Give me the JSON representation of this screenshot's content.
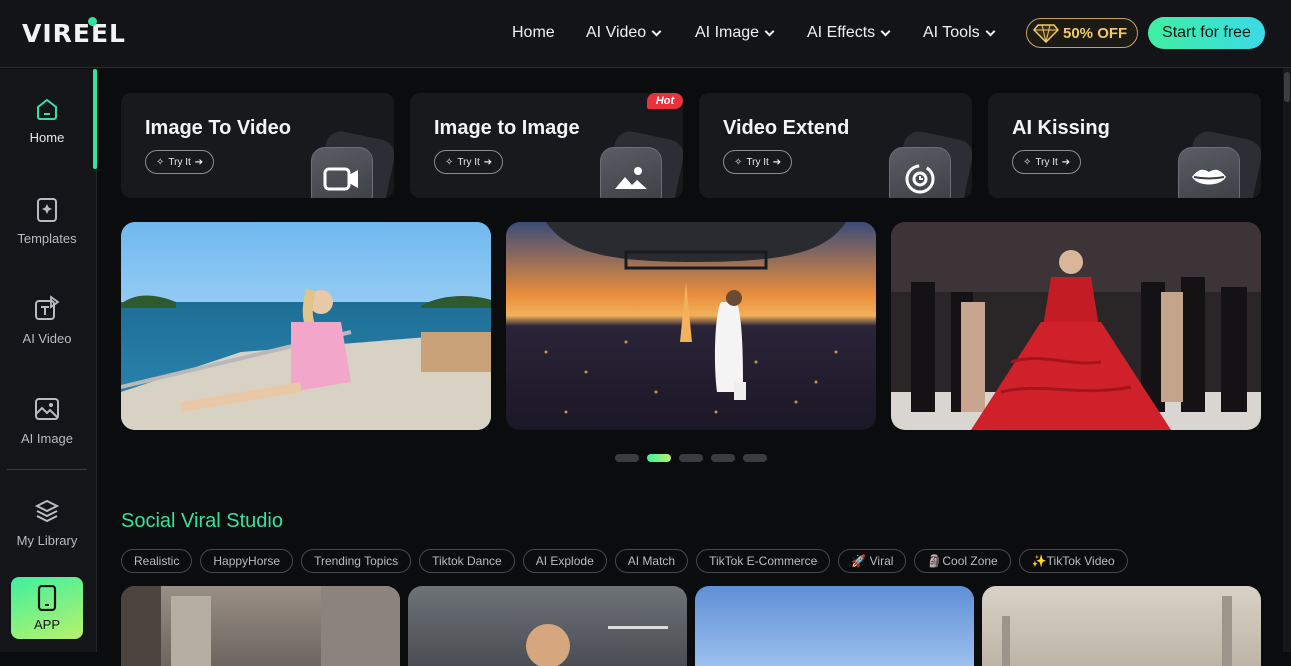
{
  "header": {
    "logo": "VIREEL",
    "nav": [
      {
        "label": "Home",
        "dropdown": false
      },
      {
        "label": "AI Video",
        "dropdown": true
      },
      {
        "label": "AI Image",
        "dropdown": true
      },
      {
        "label": "AI Effects",
        "dropdown": true
      },
      {
        "label": "AI Tools",
        "dropdown": true
      }
    ],
    "promo": "50% OFF",
    "cta": "Start for free"
  },
  "sidebar": {
    "items": [
      {
        "label": "Home",
        "icon": "home-icon",
        "active": true
      },
      {
        "label": "Templates",
        "icon": "templates-icon",
        "active": false
      },
      {
        "label": "AI Video",
        "icon": "ai-video-icon",
        "active": false
      },
      {
        "label": "AI Image",
        "icon": "ai-image-icon",
        "active": false
      },
      {
        "label": "My Library",
        "icon": "layers-icon",
        "active": false
      }
    ],
    "app_label": "APP"
  },
  "tools": [
    {
      "title": "Image To Video",
      "try": "Try It",
      "icon": "video-camera-icon",
      "hot": false
    },
    {
      "title": "Image to Image",
      "try": "Try It",
      "icon": "picture-icon",
      "hot": true
    },
    {
      "title": "Video Extend",
      "try": "Try It",
      "icon": "clock-extend-icon",
      "hot": false
    },
    {
      "title": "AI Kissing",
      "try": "Try It",
      "icon": "lips-icon",
      "hot": false
    }
  ],
  "hot_badge": "Hot",
  "carousel": {
    "slide_count": 5,
    "active_index": 1
  },
  "section": {
    "title": "Social Viral Studio",
    "chips": [
      "Realistic",
      "HappyHorse",
      "Trending Topics",
      "Tiktok Dance",
      "AI Explode",
      "AI Match",
      "TikTok E-Commerce",
      "🚀 Viral",
      "🗿Cool Zone",
      "✨TikTok Video"
    ]
  },
  "colors": {
    "accent": "#35e3a0",
    "promo_gold": "#f0c96a",
    "hot_red": "#e8323c"
  }
}
